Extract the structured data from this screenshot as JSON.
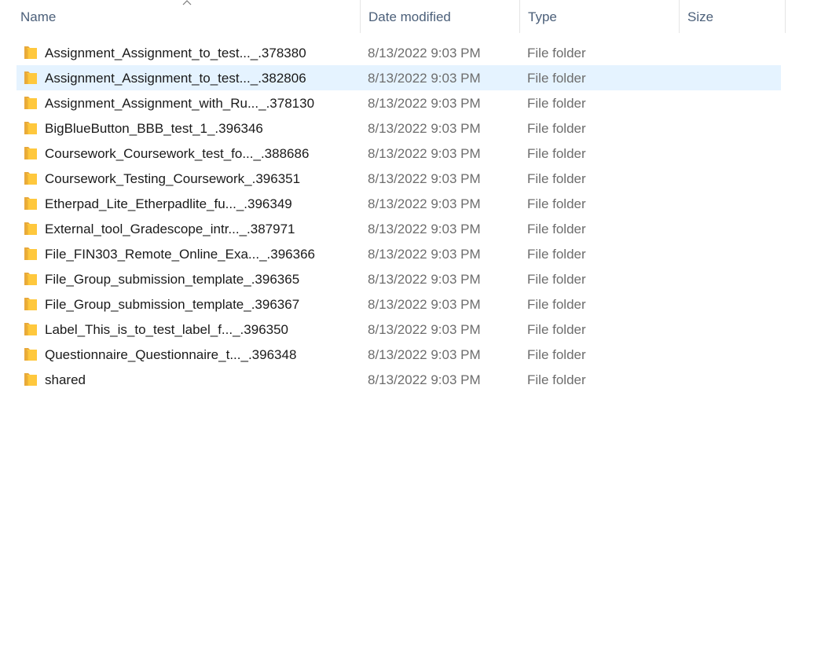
{
  "columns": {
    "name": "Name",
    "date_modified": "Date modified",
    "type": "Type",
    "size": "Size"
  },
  "sort": {
    "column": "name",
    "icon": "chevron-up-icon"
  },
  "folder_icon_color": "#ffc83d",
  "selected_row_color": "#e5f3ff",
  "rows": [
    {
      "name": "Assignment_Assignment_to_test..._.378380",
      "date": "8/13/2022 9:03 PM",
      "type": "File folder",
      "size": ""
    },
    {
      "name": "Assignment_Assignment_to_test..._.382806",
      "date": "8/13/2022 9:03 PM",
      "type": "File folder",
      "size": "",
      "selected": true
    },
    {
      "name": "Assignment_Assignment_with_Ru..._.378130",
      "date": "8/13/2022 9:03 PM",
      "type": "File folder",
      "size": ""
    },
    {
      "name": "BigBlueButton_BBB_test_1_.396346",
      "date": "8/13/2022 9:03 PM",
      "type": "File folder",
      "size": ""
    },
    {
      "name": "Coursework_Coursework_test_fo..._.388686",
      "date": "8/13/2022 9:03 PM",
      "type": "File folder",
      "size": ""
    },
    {
      "name": "Coursework_Testing_Coursework_.396351",
      "date": "8/13/2022 9:03 PM",
      "type": "File folder",
      "size": ""
    },
    {
      "name": "Etherpad_Lite_Etherpadlite_fu..._.396349",
      "date": "8/13/2022 9:03 PM",
      "type": "File folder",
      "size": ""
    },
    {
      "name": "External_tool_Gradescope_intr..._.387971",
      "date": "8/13/2022 9:03 PM",
      "type": "File folder",
      "size": ""
    },
    {
      "name": "File_FIN303_Remote_Online_Exa..._.396366",
      "date": "8/13/2022 9:03 PM",
      "type": "File folder",
      "size": ""
    },
    {
      "name": "File_Group_submission_template_.396365",
      "date": "8/13/2022 9:03 PM",
      "type": "File folder",
      "size": ""
    },
    {
      "name": "File_Group_submission_template_.396367",
      "date": "8/13/2022 9:03 PM",
      "type": "File folder",
      "size": ""
    },
    {
      "name": "Label_This_is_to_test_label_f..._.396350",
      "date": "8/13/2022 9:03 PM",
      "type": "File folder",
      "size": ""
    },
    {
      "name": "Questionnaire_Questionnaire_t..._.396348",
      "date": "8/13/2022 9:03 PM",
      "type": "File folder",
      "size": ""
    },
    {
      "name": "shared",
      "date": "8/13/2022 9:03 PM",
      "type": "File folder",
      "size": ""
    }
  ]
}
